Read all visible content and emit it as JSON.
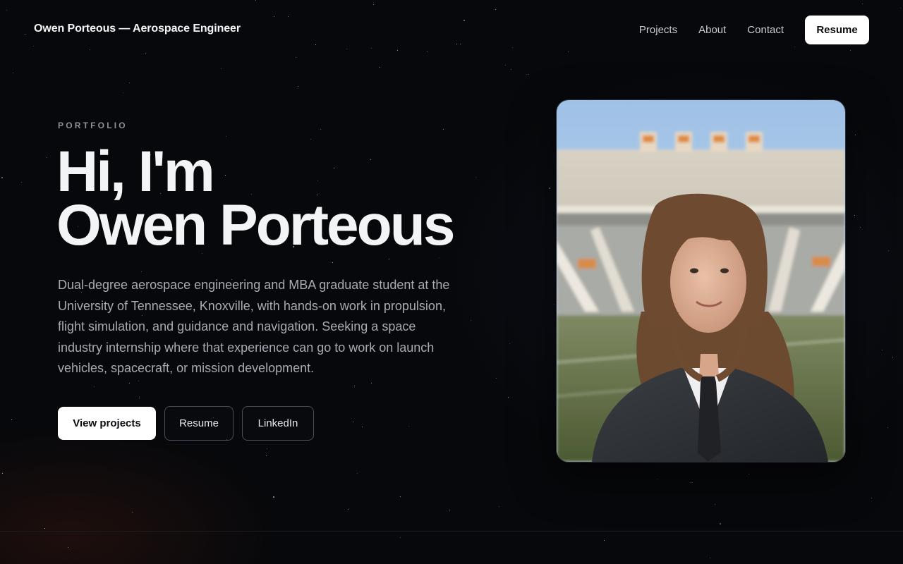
{
  "header": {
    "site_title": "Owen Porteous — Aerospace Engineer",
    "nav": [
      {
        "label": "Projects"
      },
      {
        "label": "About"
      },
      {
        "label": "Contact"
      }
    ],
    "resume_label": "Resume"
  },
  "hero": {
    "eyebrow": "PORTFOLIO",
    "title_line1": "Hi, I'm",
    "title_line2": "Owen Porteous",
    "bio": "Dual-degree aerospace engineering and MBA graduate student at the University of Tennessee, Knoxville, with hands-on work in propulsion, flight simulation, and guidance and navigation. Seeking a space industry internship where that experience can go to work on launch vehicles, spacecraft, or mission development.",
    "buttons": {
      "view_projects": "View projects",
      "resume": "Resume",
      "linkedin": "LinkedIn"
    }
  },
  "colors": {
    "background": "#07080b",
    "text_primary": "#f3f4f6",
    "text_muted": "#a7abb3",
    "button_fill": "#ffffff"
  }
}
